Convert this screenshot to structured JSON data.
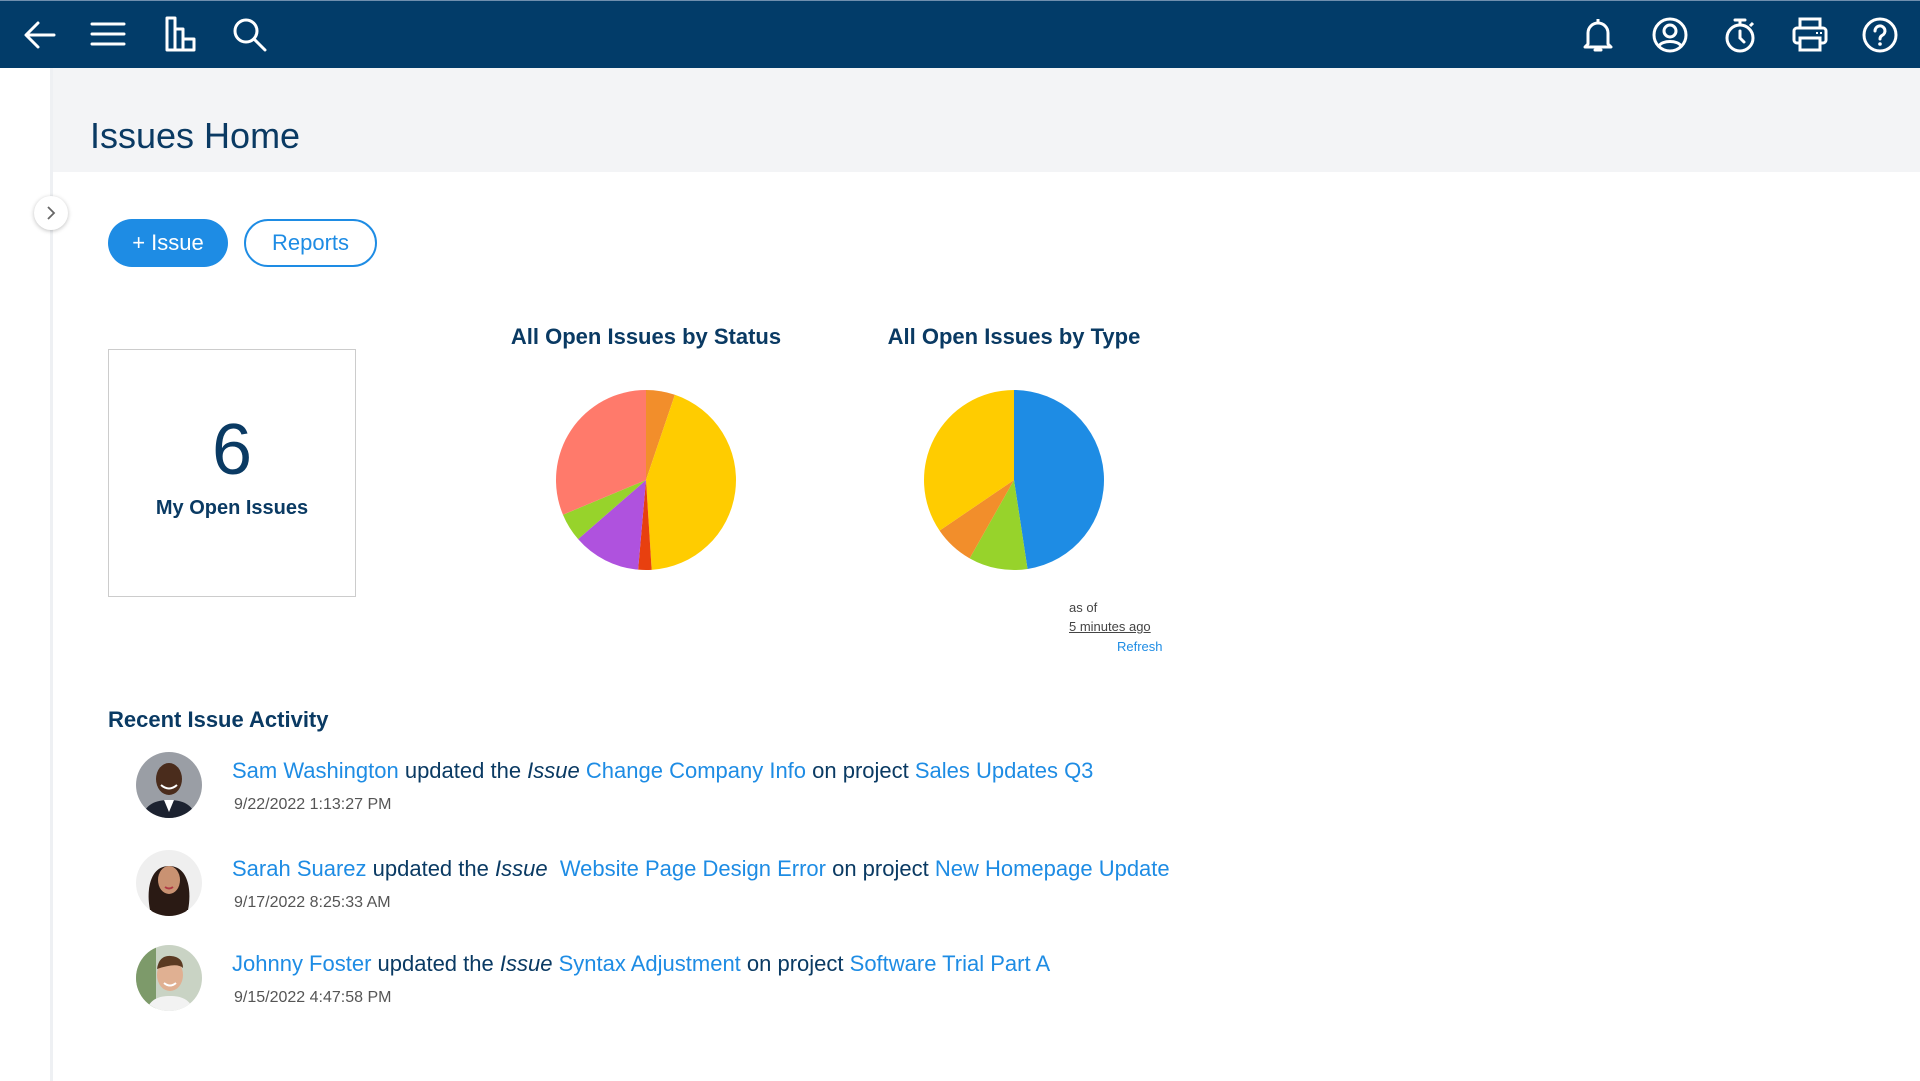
{
  "topbar": {
    "left_icons": [
      "back-arrow-icon",
      "menu-icon",
      "reports-chart-icon",
      "search-icon"
    ],
    "right_icons": [
      "bell-icon",
      "user-account-icon",
      "timer-icon",
      "print-icon",
      "help-icon"
    ],
    "background": "#023c69"
  },
  "page": {
    "title": "Issues Home"
  },
  "actions": {
    "add_issue_label": "+ Issue",
    "reports_label": "Reports",
    "accent": "#1e8ce4"
  },
  "summary_card": {
    "count": "6",
    "label": "My Open Issues"
  },
  "chart_data": [
    {
      "type": "pie",
      "title": "All Open Issues by Status",
      "start": "12 o'clock, clockwise",
      "slices": [
        {
          "color": "#f28e2b",
          "percent": 5.2
        },
        {
          "color": "#ffcc00",
          "percent": 43.8
        },
        {
          "color": "#e8400f",
          "percent": 2.4
        },
        {
          "color": "#af52de",
          "percent": 12.2
        },
        {
          "color": "#97d32b",
          "percent": 5.1
        },
        {
          "color": "#ff7a6b",
          "percent": 31.3
        }
      ]
    },
    {
      "type": "pie",
      "title": "All Open Issues by Type",
      "start": "12 o'clock, clockwise",
      "slices": [
        {
          "color": "#1e8ce4",
          "percent": 47.6
        },
        {
          "color": "#97d32b",
          "percent": 10.6
        },
        {
          "color": "#f28e2b",
          "percent": 7.3
        },
        {
          "color": "#ffcc00",
          "percent": 34.5
        }
      ]
    }
  ],
  "refresh_info": {
    "as_of": "as of",
    "time": "5 minutes ago",
    "refresh_label": "Refresh"
  },
  "activity": {
    "title": "Recent Issue Activity",
    "items": [
      {
        "user": "Sam Washington",
        "verb": " updated the ",
        "entity": "Issue",
        "sep": " ",
        "issue": "Change Company Info",
        "project_prefix": " on project ",
        "project": "Sales Updates Q3",
        "timestamp": "9/22/2022 1:13:27 PM",
        "avatar": "avatar-sam-washington"
      },
      {
        "user": "Sarah Suarez",
        "verb": " updated the ",
        "entity": "Issue",
        "sep": "  ",
        "issue": "Website Page Design Error",
        "project_prefix": " on project ",
        "project": "New Homepage Update",
        "timestamp": "9/17/2022 8:25:33 AM",
        "avatar": "avatar-sarah-suarez"
      },
      {
        "user": "Johnny Foster",
        "verb": " updated the ",
        "entity": "Issue",
        "sep": " ",
        "issue": "Syntax Adjustment",
        "project_prefix": " on project ",
        "project": "Software Trial Part A",
        "timestamp": "9/15/2022 4:47:58 PM",
        "avatar": "avatar-johnny-foster"
      }
    ]
  }
}
